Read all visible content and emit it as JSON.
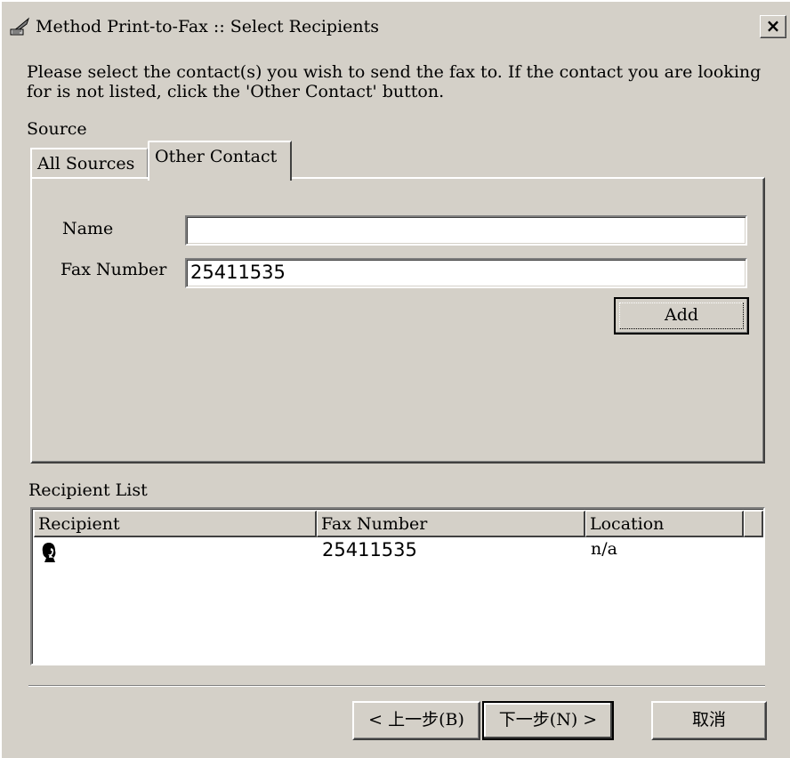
{
  "window": {
    "title": "Method Print-to-Fax :: Select Recipients",
    "close_glyph": "×",
    "icon": "fax-quill-icon"
  },
  "instruction": "Please select the contact(s) you wish to send the fax to. If the contact you are looking for is not listed, click the 'Other Contact' button.",
  "source_label": "Source",
  "tabs": [
    {
      "label": "All Sources",
      "selected": false
    },
    {
      "label": "Other Contact",
      "selected": true
    }
  ],
  "other_contact": {
    "name_label": "Name",
    "name_value": "",
    "fax_label": "Fax Number",
    "fax_value": "25411535",
    "add_label": "Add"
  },
  "recipient_list": {
    "label": "Recipient List",
    "columns": [
      "Recipient",
      "Fax Number",
      "Location",
      ""
    ],
    "rows": [
      {
        "icon": "person-icon",
        "recipient": "",
        "fax_number": "25411535",
        "location": "n/a"
      }
    ]
  },
  "footer": {
    "back_label": "< 上一步(B)",
    "next_label": "下一步(N) >",
    "cancel_label": "取消"
  }
}
